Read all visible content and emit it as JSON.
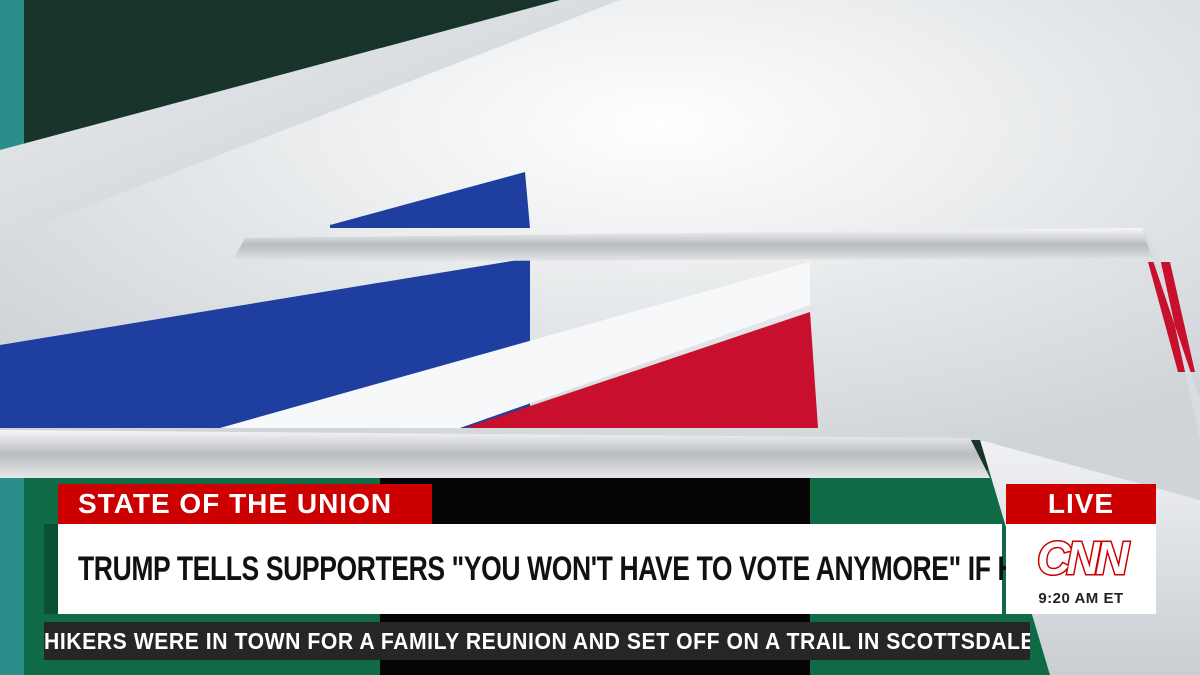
{
  "program": {
    "title": "STATE OF THE UNION"
  },
  "headline": {
    "text": "TRUMP TELLS SUPPORTERS \"YOU WON'T HAVE TO VOTE ANYMORE\" IF HE WINS"
  },
  "live_badge": {
    "label": "LIVE"
  },
  "network": {
    "logo_text": "CNN",
    "time": "9:20 AM ET"
  },
  "ticker": {
    "text": "HIKERS WERE IN TOWN FOR A FAMILY REUNION AND SET OFF ON A TRAIL IN SCOTTSDALE"
  },
  "colors": {
    "brand_red": "#cc0000",
    "flag_blue": "#1f3fa0",
    "flag_red": "#c8102e",
    "backdrop_green": "#0f6b46"
  }
}
